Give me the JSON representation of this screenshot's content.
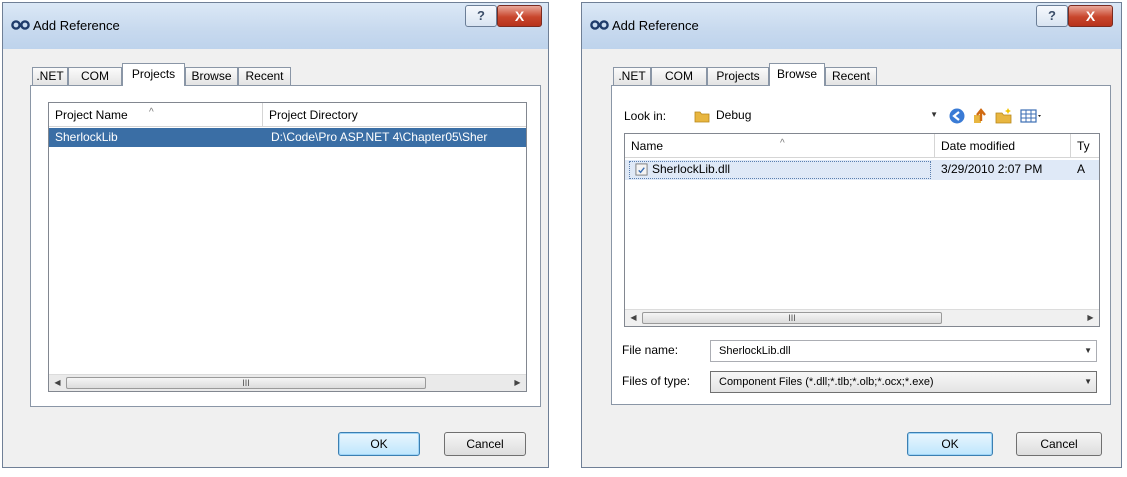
{
  "colors": {
    "selection": "#3a6ea5",
    "titlebar": "#c7d9ee",
    "close": "#c8462c"
  },
  "left": {
    "title": "Add Reference",
    "help_label": "?",
    "close_label": "X",
    "tabs": [
      ".NET",
      "COM",
      "Projects",
      "Browse",
      "Recent"
    ],
    "active_tab": "Projects",
    "columns": [
      "Project Name",
      "Project Directory"
    ],
    "rows": [
      {
        "name": "SherlockLib",
        "dir": "D:\\Code\\Pro ASP.NET 4\\Chapter05\\Sher"
      }
    ],
    "scroll_thumb": "III",
    "ok": "OK",
    "cancel": "Cancel"
  },
  "right": {
    "title": "Add Reference",
    "help_label": "?",
    "close_label": "X",
    "tabs": [
      ".NET",
      "COM",
      "Projects",
      "Browse",
      "Recent"
    ],
    "active_tab": "Browse",
    "look_in_label": "Look in:",
    "look_in_value": "Debug",
    "columns": [
      "Name",
      "Date modified",
      "Ty"
    ],
    "rows": [
      {
        "name": "SherlockLib.dll",
        "date": "3/29/2010 2:07 PM",
        "type": "A"
      }
    ],
    "scroll_thumb": "III",
    "file_name_label": "File name:",
    "file_name_value": "SherlockLib.dll",
    "file_type_label": "Files of type:",
    "file_type_value": "Component Files (*.dll;*.tlb;*.olb;*.ocx;*.exe)",
    "ok": "OK",
    "cancel": "Cancel"
  }
}
